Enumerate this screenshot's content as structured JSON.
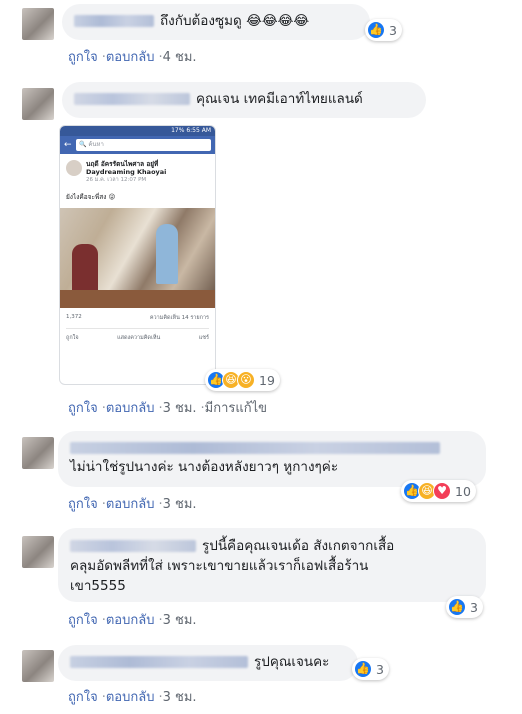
{
  "comments": [
    {
      "text": "ถึงกับต้องซูมดู 😂😂😂😂",
      "actions": {
        "like": "ถูกใจ",
        "reply": "ตอบกลับ",
        "time": "4 ชม."
      },
      "reactions": {
        "count": "3",
        "icons": [
          "like"
        ]
      }
    },
    {
      "text": "คุณเจน เทคมีเอาท์ไทยแลนด์",
      "actions": {
        "like": "ถูกใจ",
        "reply": "ตอบกลับ",
        "time": "3 ชม.",
        "edited": "มีการแก้ไข"
      },
      "reactions": {
        "count": "19",
        "icons": [
          "like",
          "haha",
          "wow"
        ]
      },
      "attachment": {
        "status": "17% 6:55 AM",
        "search_placeholder": "ค้นหา",
        "author": "นฤดี อัครรัตนไพศาล อยู่ที่",
        "place": "Daydreaming Khaoyai",
        "date": "26 ม.ค. เวลา 12:07 PM",
        "caption": "ยังไงคือจะพี่สง 😜",
        "reaction_count": "1,372",
        "comment_count": "ความคิดเห็น 14 รายการ",
        "like_label": "ถูกใจ",
        "comment_label": "แสดงความคิดเห็น",
        "share_label": "แชร์"
      }
    },
    {
      "text": "ไม่น่าใช่รูปนางค่ะ นางต้องหลังยาวๆ หูกางๆค่ะ",
      "actions": {
        "like": "ถูกใจ",
        "reply": "ตอบกลับ",
        "time": "3 ชม."
      },
      "reactions": {
        "count": "10",
        "icons": [
          "like",
          "haha",
          "love"
        ]
      }
    },
    {
      "text": "รูปนี้คือคุณเจนเด้อ สังเกตจากเสื้อ คลุมอัดพลีทที่ใส่ เพราะเขาขายแล้วเราก็เอฟเสื้อร้าน เขา5555",
      "line1": "รูปนี้คือคุณเจนเด้อ สังเกตจากเสื้อ",
      "line2": "คลุมอัดพลีทที่ใส่ เพราะเขาขายแล้วเราก็เอฟเสื้อร้าน",
      "line3": "เขา5555",
      "actions": {
        "like": "ถูกใจ",
        "reply": "ตอบกลับ",
        "time": "3 ชม."
      },
      "reactions": {
        "count": "3",
        "icons": [
          "like"
        ]
      }
    },
    {
      "text": "รูปคุณเจนคะ",
      "actions": {
        "like": "ถูกใจ",
        "reply": "ตอบกลับ",
        "time": "3 ชม."
      },
      "reactions": {
        "count": "3",
        "icons": [
          "like"
        ]
      }
    }
  ],
  "colors": {
    "link": "#4267b2",
    "meta": "#606770",
    "bubble": "#f2f3f5",
    "like": "#1877f2",
    "haha": "#f7b125",
    "love": "#f33e58"
  },
  "icons": {
    "like": "thumbs-up-icon",
    "haha": "laughing-face-icon",
    "wow": "surprised-face-icon",
    "love": "heart-icon",
    "search": "search-icon",
    "back": "back-arrow-icon"
  }
}
